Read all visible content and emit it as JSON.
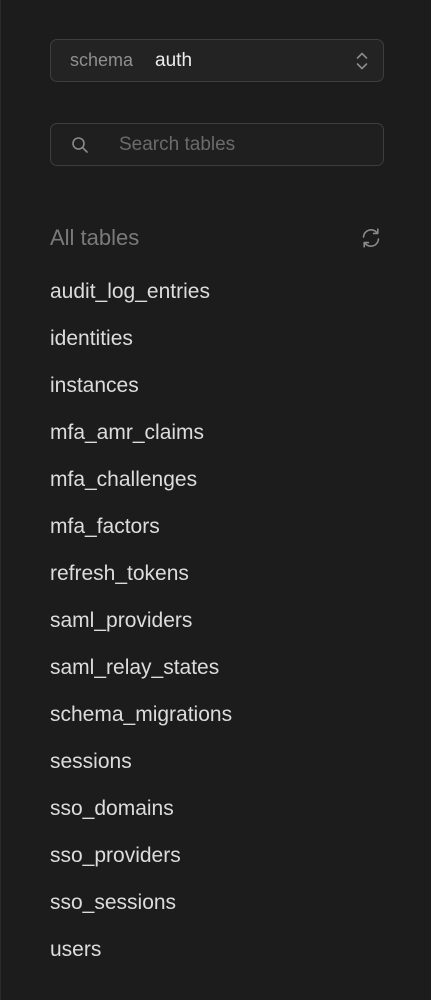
{
  "schema_selector": {
    "prefix": "schema",
    "value": "auth",
    "icon": "chevron-up-down-icon"
  },
  "search": {
    "placeholder": "Search tables",
    "value": "",
    "icon": "search-icon"
  },
  "tables_header": {
    "title": "All tables",
    "refresh_icon": "refresh-icon"
  },
  "tables": [
    "audit_log_entries",
    "identities",
    "instances",
    "mfa_amr_claims",
    "mfa_challenges",
    "mfa_factors",
    "refresh_tokens",
    "saml_providers",
    "saml_relay_states",
    "schema_migrations",
    "sessions",
    "sso_domains",
    "sso_providers",
    "sso_sessions",
    "users"
  ],
  "colors": {
    "background": "#1c1c1c",
    "border": "#3e3e3e",
    "text_primary": "#dcdcdc",
    "text_muted": "#7a7a7a"
  }
}
